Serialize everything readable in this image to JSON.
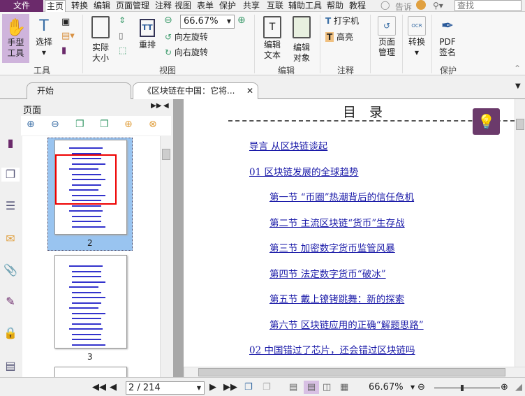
{
  "menu": {
    "file": "文件",
    "items": [
      "主页",
      "转换",
      "编辑",
      "页面管理",
      "注释",
      "视图",
      "表单",
      "保护",
      "共享",
      "互联",
      "辅助工具",
      "帮助",
      "教程"
    ],
    "tell": "告诉",
    "search_placeholder": "查找"
  },
  "ribbon": {
    "hand": "手型\n工具",
    "select": "选择",
    "actual_size": "实际\n大小",
    "reflow": "重排",
    "zoom_value": "66.67%",
    "rotate_left": "向左旋转",
    "rotate_right": "向右旋转",
    "edit_text": "编辑\n文本",
    "edit_object": "编辑\n对象",
    "typewriter": "打字机",
    "highlight": "高亮",
    "page_manage": "页面\n管理",
    "convert": "转换",
    "pdf_sign": "PDF\n签名",
    "groups": {
      "tools": "工具",
      "view": "视图",
      "edit": "编辑",
      "comment": "注释",
      "protect": "保护"
    }
  },
  "tabs": [
    {
      "label": "开始"
    },
    {
      "label": "《区块链在中国：它将...",
      "active": true
    }
  ],
  "panel": {
    "title": "页面",
    "thumbs": [
      {
        "page": "2",
        "selected": true
      },
      {
        "page": "3"
      }
    ]
  },
  "document": {
    "title": "目　录",
    "toc": [
      {
        "text": "导言 从区块链谈起",
        "level": 1
      },
      {
        "text": "01 区块链发展的全球趋势",
        "level": 1
      },
      {
        "text": "第一节 “币圈”热潮背后的信任危机",
        "level": 2
      },
      {
        "text": "第二节 主流区块链“货币”生存战",
        "level": 2
      },
      {
        "text": "第三节 加密数字货币监管风暴",
        "level": 2
      },
      {
        "text": "第四节 法定数字货币“破冰”",
        "level": 2
      },
      {
        "text": "第五节 戴上镣铐跳舞：新的探索",
        "level": 2
      },
      {
        "text": "第六节 区块链应用的正确“解题思路”",
        "level": 2
      },
      {
        "text": "02 中国错过了芯片，还会错过区块链吗",
        "level": 1
      }
    ]
  },
  "status": {
    "page_input": "2 / 214",
    "zoom": "66.67%",
    "zoom_slider_percent": 40
  },
  "colors": {
    "accent": "#6b2a6b",
    "link": "#1a1aa8",
    "selected": "#99c4f0"
  }
}
